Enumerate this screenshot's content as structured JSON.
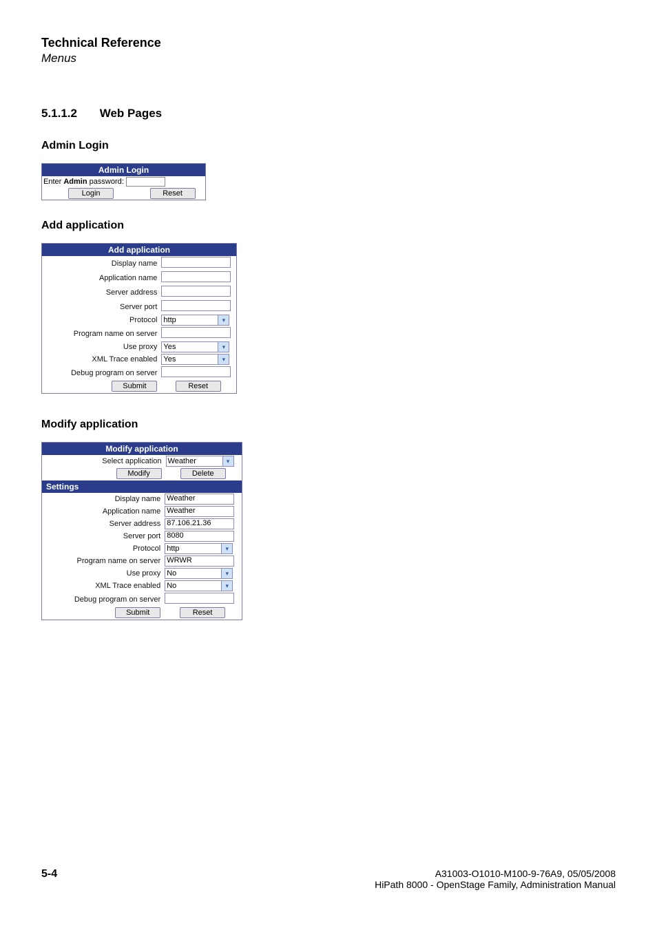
{
  "header": {
    "tech_ref": "Technical Reference",
    "menus": "Menus"
  },
  "section": {
    "number": "5.1.1.2",
    "title": "Web Pages"
  },
  "admin_login": {
    "heading": "Admin Login",
    "panel_title": "Admin Login",
    "prompt_prefix": "Enter ",
    "prompt_bold": "Admin",
    "prompt_suffix": " password:",
    "login_btn": "Login",
    "reset_btn": "Reset"
  },
  "add_app": {
    "heading": "Add application",
    "panel_title": "Add application",
    "labels": {
      "display_name": "Display name",
      "application_name": "Application name",
      "server_address": "Server address",
      "server_port": "Server port",
      "protocol": "Protocol",
      "program_name": "Program name on server",
      "use_proxy": "Use proxy",
      "xml_trace": "XML Trace enabled",
      "debug": "Debug program on server"
    },
    "values": {
      "protocol": "http",
      "use_proxy": "Yes",
      "xml_trace": "Yes"
    },
    "submit_btn": "Submit",
    "reset_btn": "Reset"
  },
  "mod_app": {
    "heading": "Modify application",
    "panel_title": "Modify application",
    "select_label": "Select application",
    "select_value": "Weather",
    "modify_btn": "Modify",
    "delete_btn": "Delete",
    "settings_bar": "Settings",
    "labels": {
      "display_name": "Display name",
      "application_name": "Application name",
      "server_address": "Server address",
      "server_port": "Server port",
      "protocol": "Protocol",
      "program_name": "Program name on server",
      "use_proxy": "Use proxy",
      "xml_trace": "XML Trace enabled",
      "debug": "Debug program on server"
    },
    "values": {
      "display_name": "Weather",
      "application_name": "Weather",
      "server_address": "87.106.21.36",
      "server_port": "8080",
      "protocol": "http",
      "program_name": "WRWR",
      "use_proxy": "No",
      "xml_trace": "No"
    },
    "submit_btn": "Submit",
    "reset_btn": "Reset"
  },
  "footer": {
    "page": "5-4",
    "doc_id": "A31003-O1010-M100-9-76A9, 05/05/2008",
    "doc_title": "HiPath 8000 - OpenStage Family, Administration Manual"
  }
}
